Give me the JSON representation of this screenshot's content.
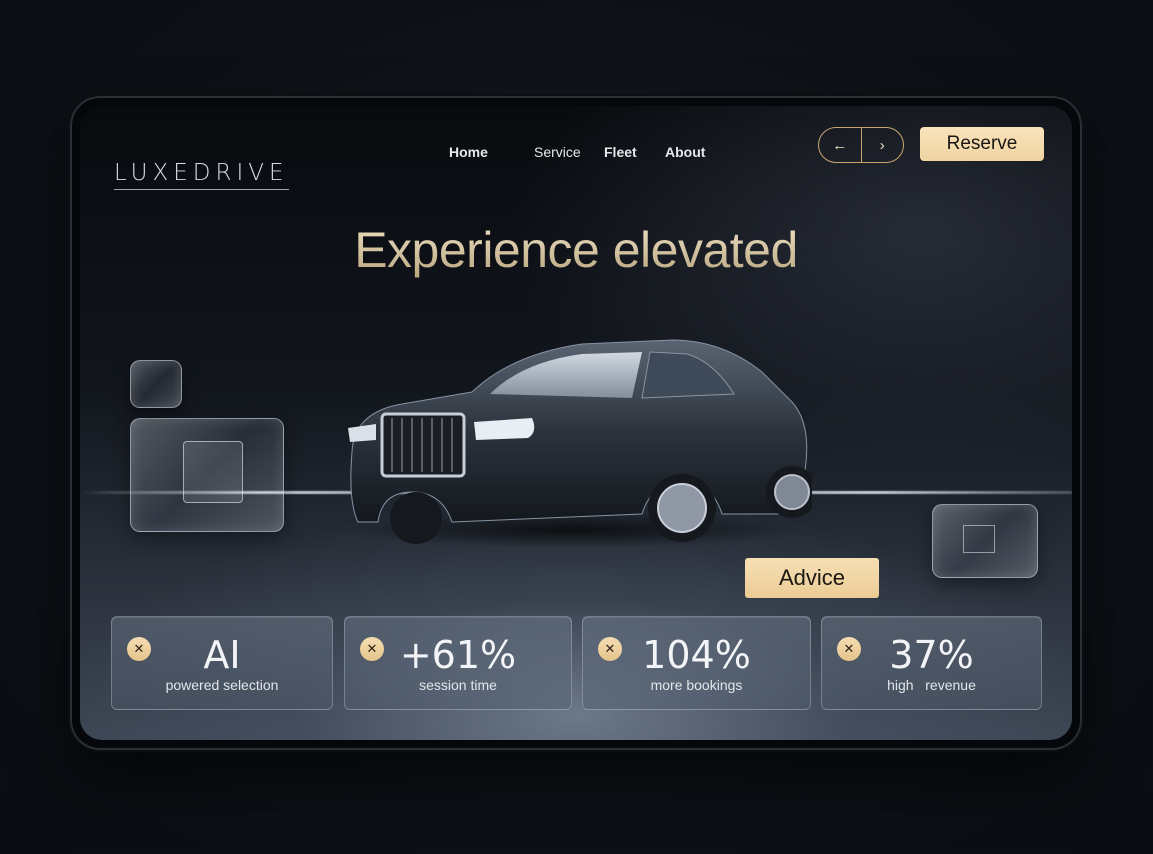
{
  "brand": {
    "logo": "LUXEDRIVE"
  },
  "nav": {
    "items": [
      "Home",
      "Service",
      "Fleet",
      "About"
    ]
  },
  "controls": {
    "prev_icon": "arrow-left-icon",
    "next_icon": "chevron-right-icon",
    "reserve_label": "Reserve"
  },
  "hero": {
    "title": "Experience elevated"
  },
  "advice_label": "Advice",
  "stats": [
    {
      "value": "AI",
      "label": "powered selection"
    },
    {
      "value": "+61%",
      "label": "session time"
    },
    {
      "value": "104%",
      "label": "more bookings"
    },
    {
      "value": "37%",
      "label": "high   revenue"
    }
  ],
  "colors": {
    "accent": "#f0d4a2",
    "accent_border": "#c9a56d",
    "hero_text": "#d8c7a2",
    "background": "#0d1016"
  }
}
